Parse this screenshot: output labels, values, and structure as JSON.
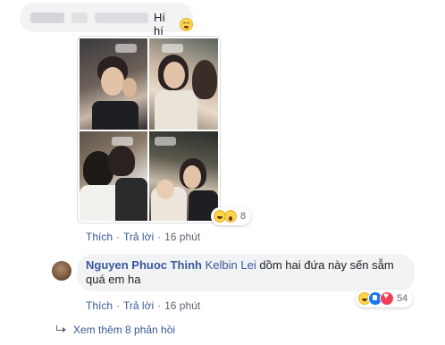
{
  "comment1": {
    "text": "Hí hí",
    "emoji_icon": "grinning-emoji-icon",
    "reactions": {
      "icons": [
        "haha-icon",
        "wow-icon"
      ],
      "count": "8"
    },
    "actions": {
      "like": "Thích",
      "reply": "Trả lời",
      "time": "16 phút"
    }
  },
  "comment2": {
    "author": "Nguyen Phuoc Thinh",
    "mention": "Kelbin Lei",
    "text": "dồm hai đứa này sến sẫm quá em ha",
    "reactions": {
      "icons": [
        "haha-icon",
        "like-icon",
        "love-icon"
      ],
      "count": "54"
    },
    "actions": {
      "like": "Thích",
      "reply": "Trả lời",
      "time": "16 phút"
    }
  },
  "more_replies": {
    "label": "Xem thêm 8 phản hồi",
    "icon": "reply-arrow-icon"
  },
  "colors": {
    "link": "#385898",
    "bubble": "#f2f3f5",
    "meta": "#606770",
    "like": "#1877f2",
    "love": "#f33e58"
  }
}
